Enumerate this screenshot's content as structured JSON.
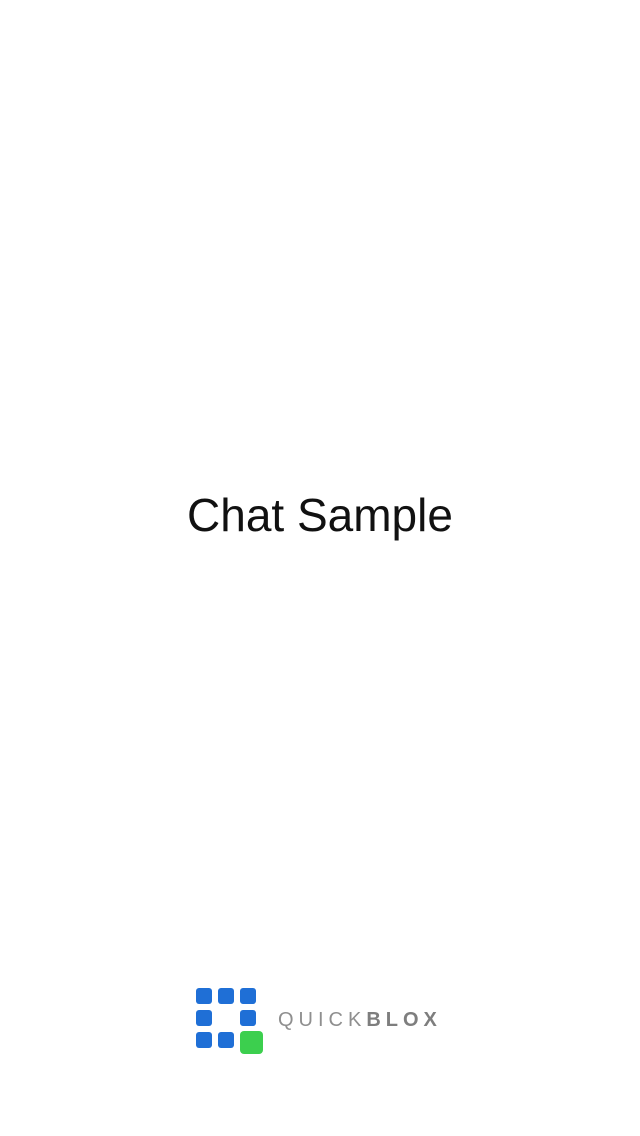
{
  "splash": {
    "title": "Chat Sample",
    "brand": {
      "wordmark_light": "QUICK",
      "wordmark_bold": "BLOX",
      "logo_icon": "quickblox-logo-icon",
      "colors": {
        "logo_blue": "#1f6fd6",
        "logo_green": "#3ccf4e",
        "wordmark": "#8a8a8a"
      }
    }
  }
}
